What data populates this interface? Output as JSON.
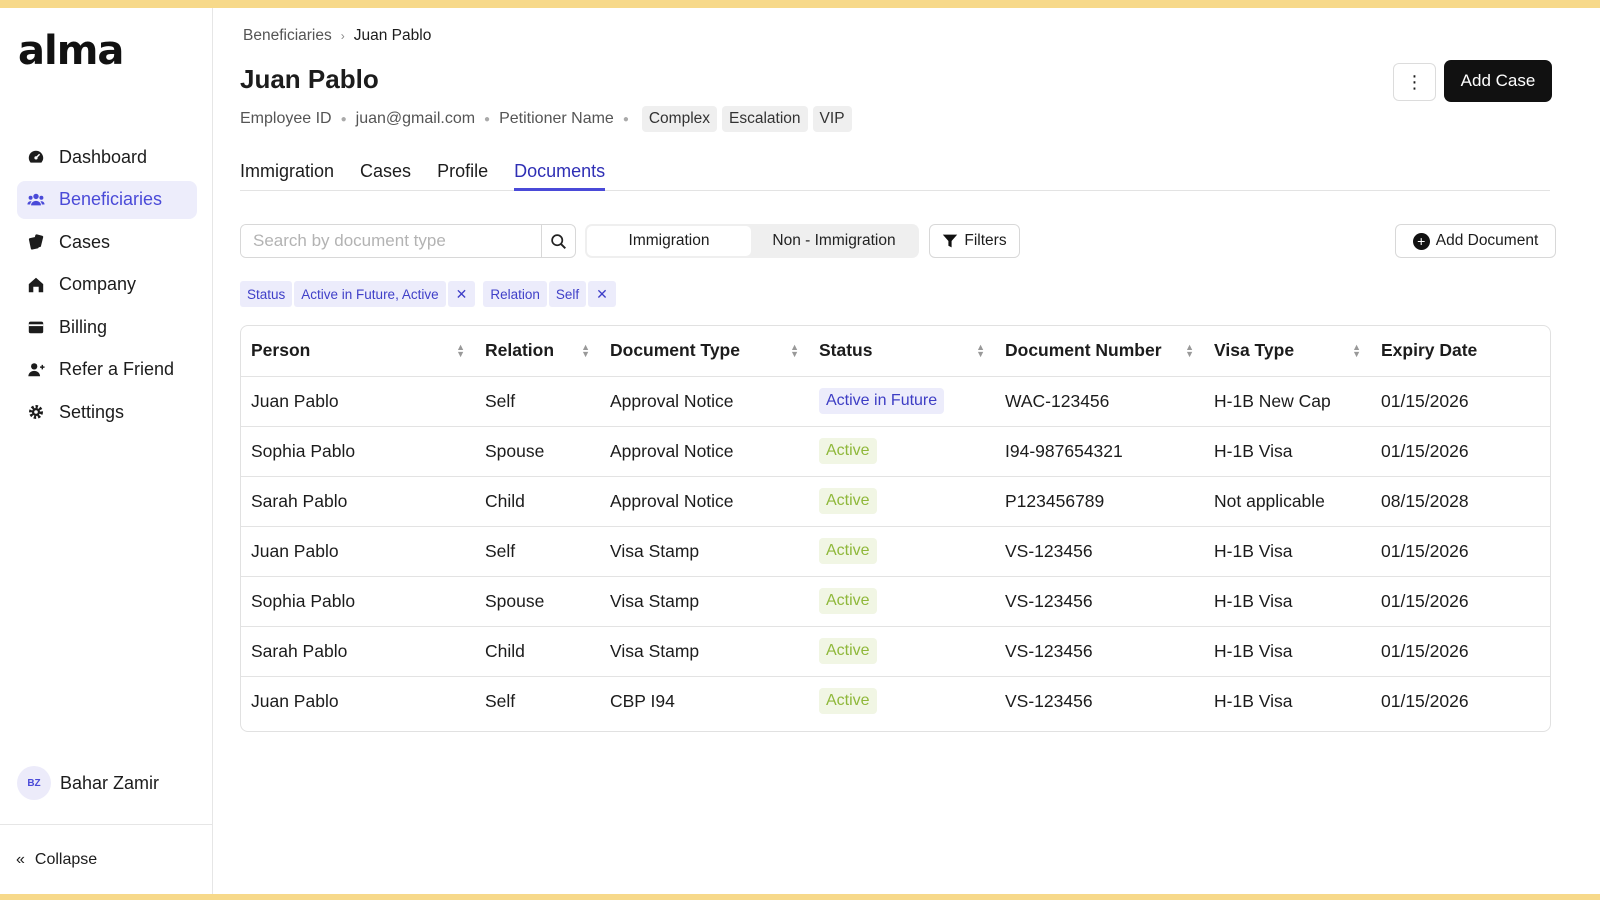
{
  "app": {
    "logo": "alma"
  },
  "sidebar": {
    "items": [
      {
        "label": "Dashboard",
        "icon": "dashboard-icon",
        "active": false
      },
      {
        "label": "Beneficiaries",
        "icon": "users-icon",
        "active": true
      },
      {
        "label": "Cases",
        "icon": "cases-icon",
        "active": false
      },
      {
        "label": "Company",
        "icon": "home-icon",
        "active": false
      },
      {
        "label": "Billing",
        "icon": "wallet-icon",
        "active": false
      },
      {
        "label": "Refer a Friend",
        "icon": "add-user-icon",
        "active": false
      },
      {
        "label": "Settings",
        "icon": "gear-icon",
        "active": false
      }
    ],
    "user": {
      "initials": "BZ",
      "name": "Bahar Zamir"
    },
    "collapse_label": "Collapse"
  },
  "breadcrumb": {
    "parent": "Beneficiaries",
    "current": "Juan Pablo"
  },
  "header": {
    "title": "Juan Pablo",
    "meta": [
      "Employee ID",
      "juan@gmail.com",
      "Petitioner Name"
    ],
    "tags": [
      "Complex",
      "Escalation",
      "VIP"
    ],
    "add_case_label": "Add Case"
  },
  "tabs": [
    {
      "label": "Immigration",
      "active": false
    },
    {
      "label": "Cases",
      "active": false
    },
    {
      "label": "Profile",
      "active": false
    },
    {
      "label": "Documents",
      "active": true
    }
  ],
  "toolbar": {
    "search_placeholder": "Search by document type",
    "segments": [
      "Immigration",
      "Non - Immigration"
    ],
    "filters_label": "Filters",
    "add_document_label": "Add Document"
  },
  "chips": [
    {
      "key": "Status",
      "value": "Active in Future, Active"
    },
    {
      "key": "Relation",
      "value": "Self"
    }
  ],
  "table": {
    "columns": [
      "Person",
      "Relation",
      "Document Type",
      "Status",
      "Document Number",
      "Visa Type",
      "Expiry Date"
    ],
    "rows": [
      [
        "Juan Pablo",
        "Self",
        "Approval Notice",
        "Active in Future",
        "WAC-123456",
        "H-1B New Cap",
        "01/15/2026"
      ],
      [
        "Sophia Pablo",
        "Spouse",
        "Approval Notice",
        "Active",
        "I94-987654321",
        "H-1B Visa",
        "01/15/2026"
      ],
      [
        "Sarah Pablo",
        "Child",
        "Approval Notice",
        "Active",
        "P123456789",
        "Not applicable",
        "08/15/2028"
      ],
      [
        "Juan Pablo",
        "Self",
        "Visa Stamp",
        "Active",
        "VS-123456",
        "H-1B Visa",
        "01/15/2026"
      ],
      [
        "Sophia Pablo",
        "Spouse",
        "Visa Stamp",
        "Active",
        "VS-123456",
        "H-1B Visa",
        "01/15/2026"
      ],
      [
        "Sarah Pablo",
        "Child",
        "Visa Stamp",
        "Active",
        "VS-123456",
        "H-1B Visa",
        "01/15/2026"
      ],
      [
        "Juan Pablo",
        "Self",
        "CBP I94",
        "Active",
        "VS-123456",
        "H-1B Visa",
        "01/15/2026"
      ]
    ]
  },
  "colors": {
    "accent": "#4a4ad8",
    "active_status": "#8fb83a",
    "frame": "#f7d98a"
  }
}
